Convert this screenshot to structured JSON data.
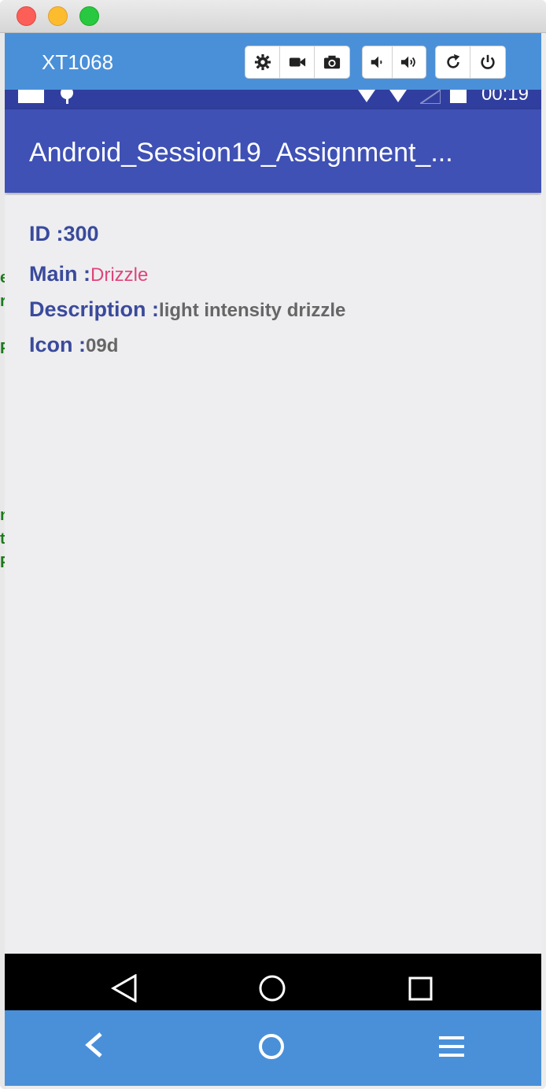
{
  "device": {
    "name": "XT1068"
  },
  "statusbar": {
    "time": "00:19"
  },
  "app": {
    "title": "Android_Session19_Assignment_..."
  },
  "weather": {
    "id_label": "ID :",
    "id_value": "300",
    "main_label": "Main :",
    "main_value": "Drizzle",
    "description_label": "Description :",
    "description_value": "light intensity drizzle",
    "icon_label": "Icon :",
    "icon_value": "09d"
  },
  "colors": {
    "accent": "#4a90d9",
    "appbar": "#3f51b5",
    "statusbar": "#303f9f",
    "label": "#3a4a9c",
    "main_value": "#e0447a"
  }
}
